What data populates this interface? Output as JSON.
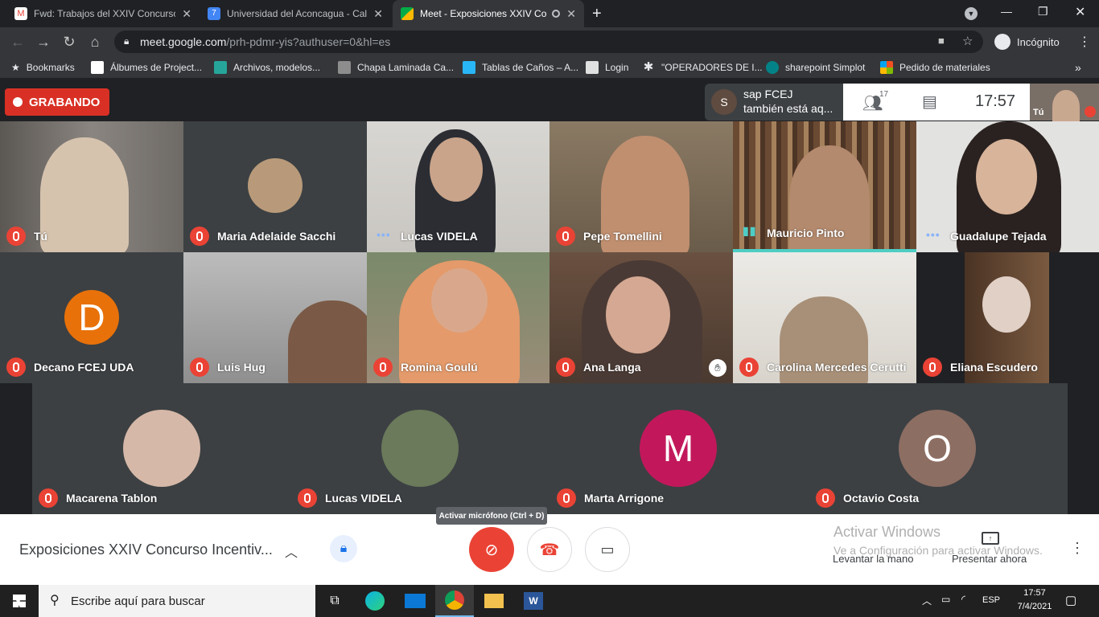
{
  "browser": {
    "tabs": [
      {
        "title": "Fwd: Trabajos del XXIV Concurso",
        "icon": "gmail-icon"
      },
      {
        "title": "Universidad del Aconcagua - Cale",
        "icon": "calendar-icon"
      },
      {
        "title": "Meet - Exposiciones XXIV Co",
        "icon": "meet-icon"
      }
    ],
    "url_host": "meet.google.com",
    "url_path": "/prh-pdmr-yis?authuser=0&hl=es",
    "profile": "Incógnito",
    "bookmarks": [
      "Bookmarks",
      "Álbumes de Project...",
      "Archivos, modelos...",
      "Chapa Laminada Ca...",
      "Tablas de Caños – A...",
      "Login",
      "\"OPERADORES DE I...",
      "sharepoint Simplot",
      "Pedido de materiales"
    ]
  },
  "meet": {
    "recording_label": "GRABANDO",
    "join_notice": {
      "initial": "S",
      "line1": "sap FCEJ",
      "line2": "también está aq..."
    },
    "participant_count": "17",
    "clock": "17:57",
    "self_label": "Tú",
    "participants_row1": [
      "Tú",
      "Maria Adelaide Sacchi",
      "Lucas VIDELA",
      "Pepe Tomellini",
      "Mauricio Pinto",
      "Guadalupe Tejada"
    ],
    "participants_row2": [
      "Decano FCEJ UDA",
      "Luis Hug",
      "Romina Goulú",
      "Ana Langa",
      "Carolina Mercedes Cerutti",
      "Eliana Escudero"
    ],
    "participants_row3": [
      "Macarena Tablon",
      "Lucas VIDELA",
      "Marta Arrigone",
      "Octavio Costa"
    ],
    "avatar_letters": {
      "decano": "D",
      "marta": "M",
      "octavio": "O"
    },
    "colors": {
      "record": "#d93025",
      "decano": "#e8710a",
      "marta": "#c2185b",
      "octavio": "#8d6e63",
      "speaking": "#4ecdc4"
    },
    "meeting_title": "Exposiciones XXIV Concurso Incentiv...",
    "tooltip": "Activar micrófono (Ctrl + D)",
    "raise_hand": "Levantar la mano",
    "present": "Presentar ahora",
    "watermark1": "Activar Windows",
    "watermark2": "Ve a Configuración para activar Windows."
  },
  "taskbar": {
    "search_placeholder": "Escribe aquí para buscar",
    "lang": "ESP",
    "time": "17:57",
    "date": "7/4/2021"
  }
}
